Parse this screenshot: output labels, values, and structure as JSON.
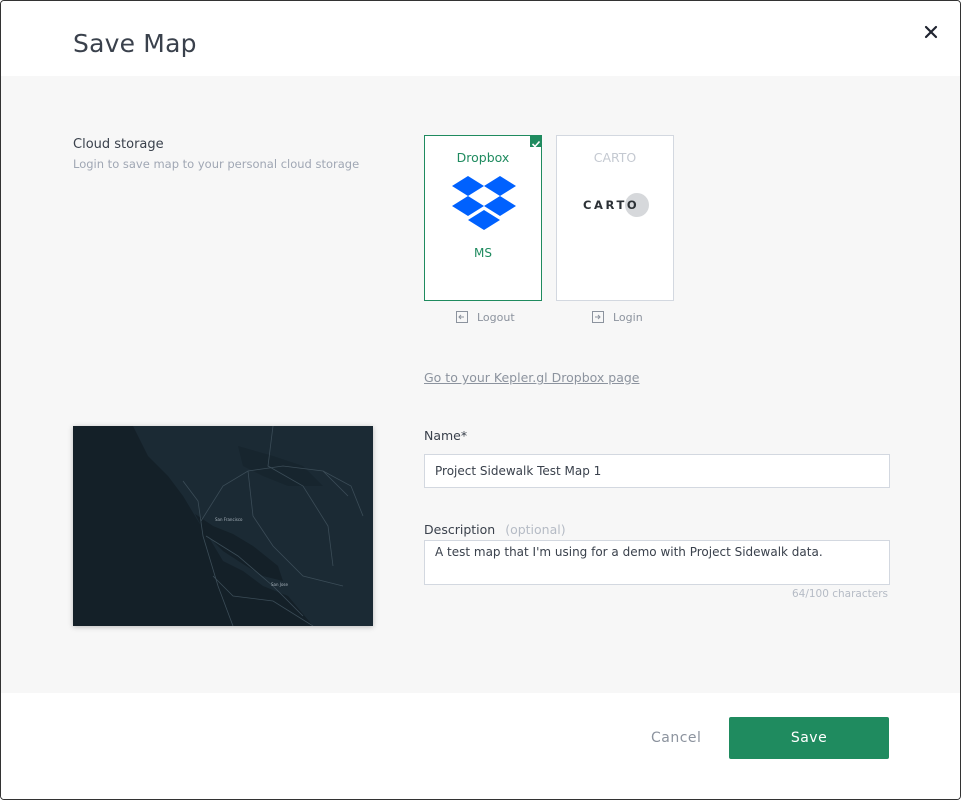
{
  "dialog": {
    "title": "Save Map"
  },
  "cloud_storage": {
    "title": "Cloud storage",
    "subtitle": "Login to save map to your personal cloud storage",
    "providers": [
      {
        "name": "Dropbox",
        "user": "MS",
        "selected": true,
        "action": "Logout"
      },
      {
        "name": "CARTO",
        "logo_text": "CARTO",
        "selected": false,
        "action": "Login"
      }
    ],
    "page_link": "Go to your Kepler.gl Dropbox page"
  },
  "map_thumbnail": {
    "labels": [
      "San Francisco",
      "San Jose"
    ]
  },
  "form": {
    "name_label": "Name*",
    "name_value": "Project Sidewalk Test Map 1",
    "description_label": "Description",
    "description_optional": "(optional)",
    "description_value": "A test map that I'm using for a demo with Project Sidewalk data.",
    "char_count": "64/100 characters"
  },
  "footer": {
    "cancel_label": "Cancel",
    "save_label": "Save"
  },
  "colors": {
    "accent": "#1f8b5f",
    "dropbox_blue": "#0061fe",
    "map_bg": "#142028"
  }
}
